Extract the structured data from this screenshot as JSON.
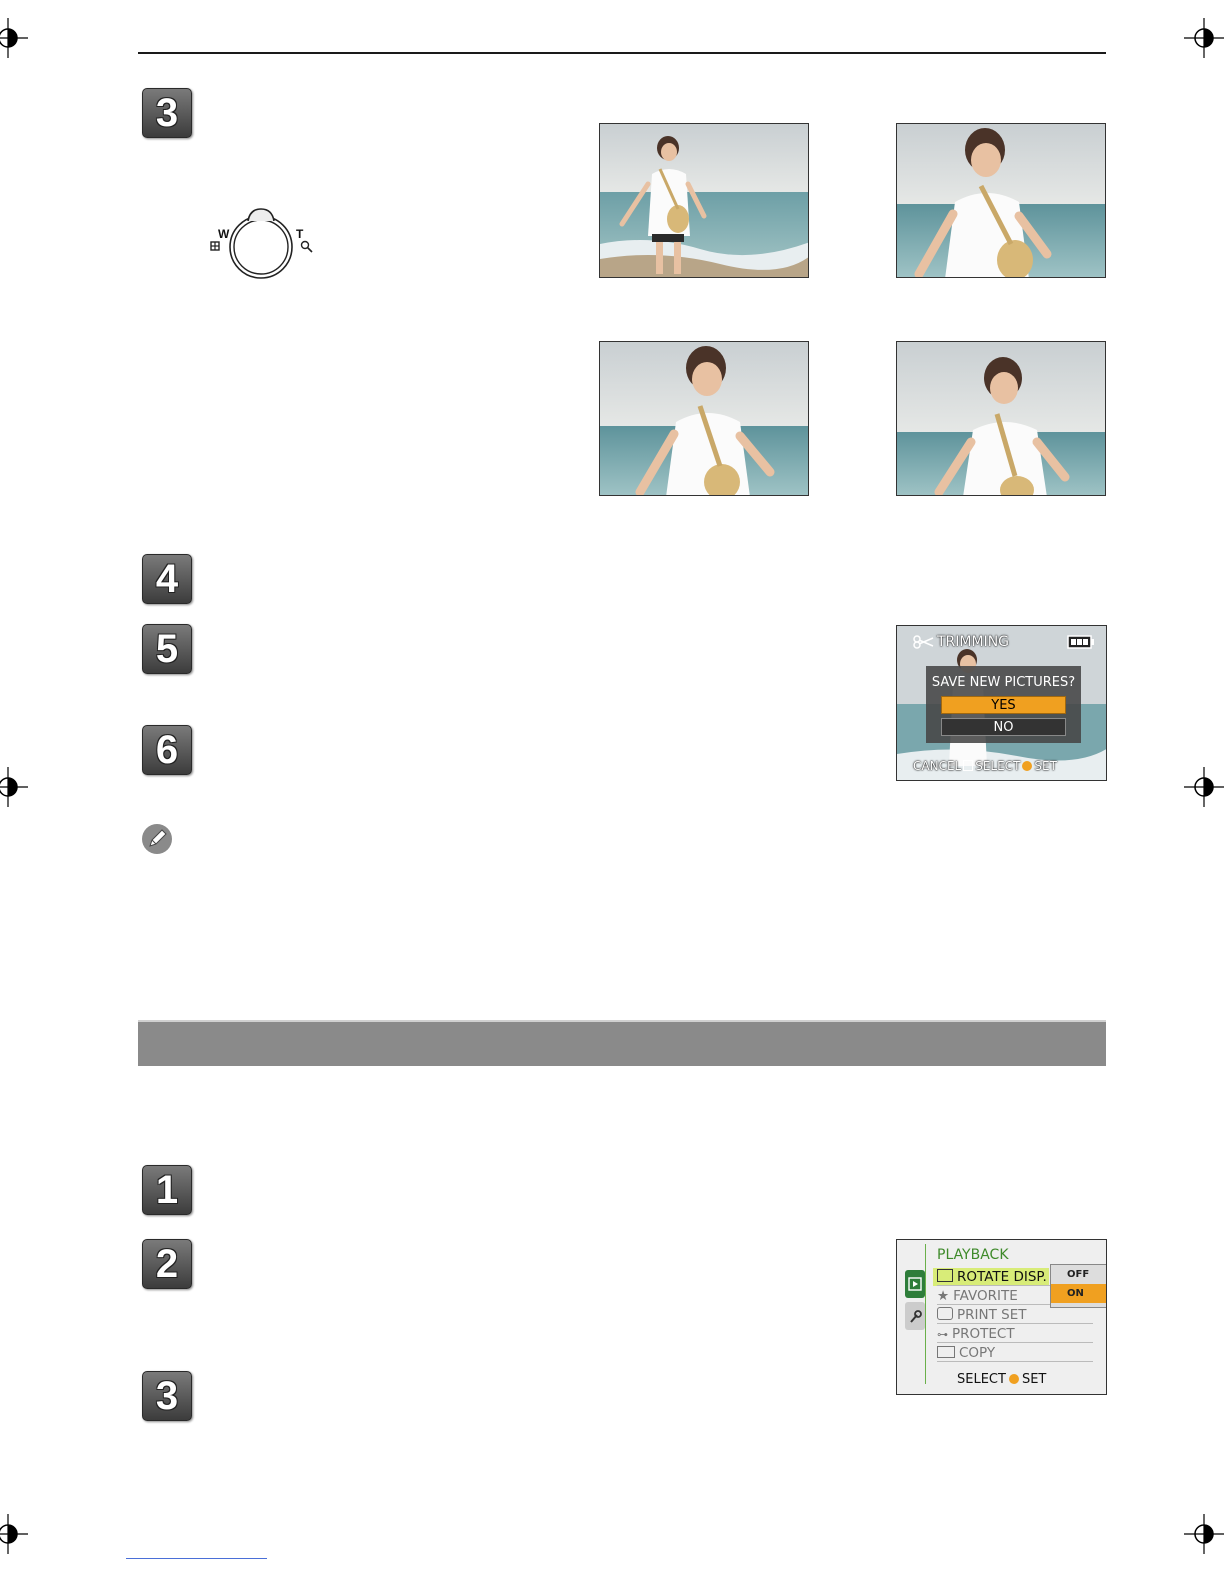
{
  "steps": {
    "s3a": "3",
    "s4": "4",
    "s5": "5",
    "s6": "6",
    "s1b": "1",
    "s2b": "2",
    "s3b": "3"
  },
  "zoom_lever": {
    "wide_label": "W",
    "tele_label": "T"
  },
  "trimming_screen": {
    "title": "TRIMMING",
    "dialog_question": "SAVE NEW PICTURES?",
    "yes_label": "YES",
    "no_label": "NO",
    "cancel_label": "CANCEL",
    "select_label": "SELECT",
    "set_label": "SET",
    "accent_color": "#f0a020"
  },
  "playback_menu": {
    "title": "PLAYBACK",
    "items": [
      {
        "label": "ROTATE DISP."
      },
      {
        "label": "FAVORITE"
      },
      {
        "label": "PRINT SET"
      },
      {
        "label": "PROTECT"
      },
      {
        "label": "COPY"
      }
    ],
    "options": [
      "OFF",
      "ON"
    ],
    "selected_option": "ON",
    "select_label": "SELECT",
    "set_label": "SET",
    "highlight_color": "#d8ec78"
  }
}
